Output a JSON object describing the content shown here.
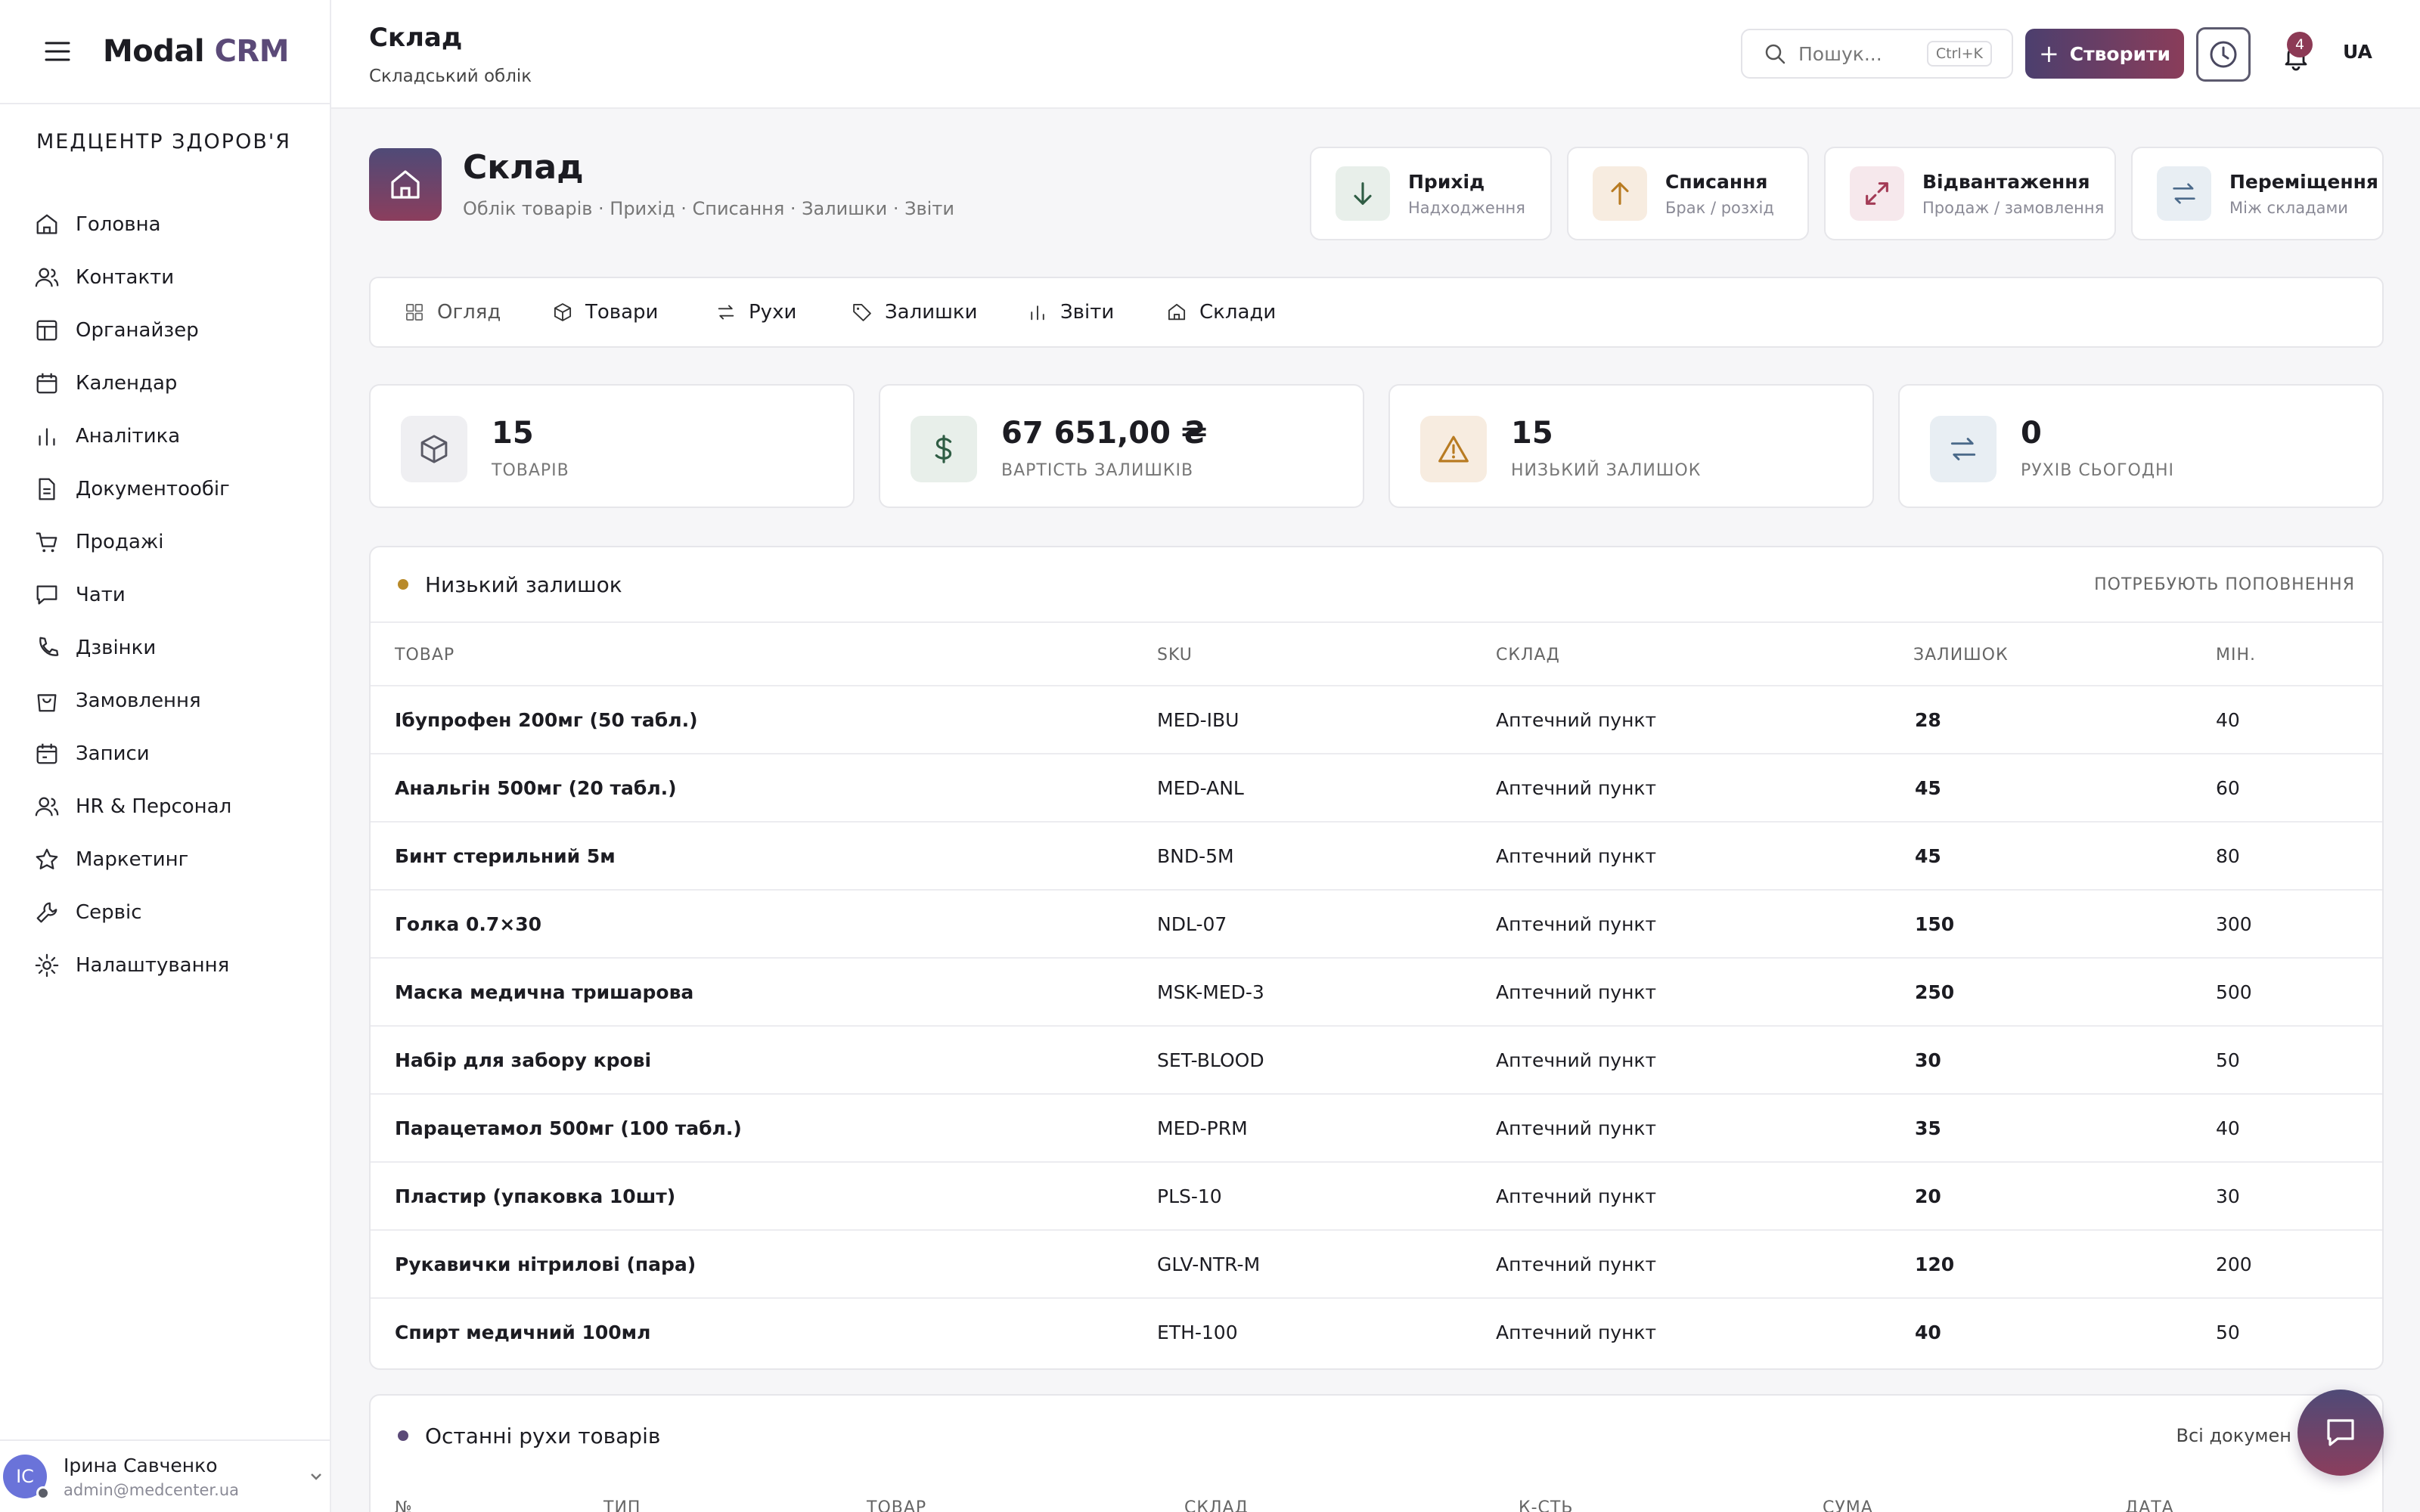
{
  "brand": {
    "name": "Modal",
    "suffix": "CRM"
  },
  "organization": "МЕДЦЕНТР ЗДОРОВ'Я",
  "sidebar": {
    "items": [
      {
        "label": "Головна",
        "icon": "home-icon"
      },
      {
        "label": "Контакти",
        "icon": "users-icon"
      },
      {
        "label": "Органайзер",
        "icon": "layout-icon"
      },
      {
        "label": "Календар",
        "icon": "calendar-icon"
      },
      {
        "label": "Аналітика",
        "icon": "bar-chart-icon"
      },
      {
        "label": "Документообіг",
        "icon": "document-icon"
      },
      {
        "label": "Продажі",
        "icon": "cart-icon"
      },
      {
        "label": "Чати",
        "icon": "chat-icon"
      },
      {
        "label": "Дзвінки",
        "icon": "phone-icon"
      },
      {
        "label": "Замовлення",
        "icon": "bag-icon"
      },
      {
        "label": "Записи",
        "icon": "calendar-check-icon"
      },
      {
        "label": "HR & Персонал",
        "icon": "users-icon"
      },
      {
        "label": "Маркетинг",
        "icon": "star-icon"
      },
      {
        "label": "Сервіс",
        "icon": "wrench-icon"
      },
      {
        "label": "Налаштування",
        "icon": "gear-icon"
      }
    ]
  },
  "user": {
    "initials": "IC",
    "name": "Ірина Савченко",
    "email": "admin@medcenter.ua"
  },
  "header": {
    "title": "Склад",
    "subtitle": "Складський облік",
    "search_placeholder": "Пошук...",
    "search_shortcut": "Ctrl+K",
    "create_label": "Створити",
    "notifications_count": "4",
    "language": "UA"
  },
  "hero": {
    "title": "Склад",
    "subtitle": "Облік товарів · Прихід · Списання · Залишки · Звіти"
  },
  "quick_actions": [
    {
      "title": "Прихід",
      "sub": "Надходження",
      "icon": "arrow-down-icon",
      "color": "#2f5d44",
      "bg": "#e8efea"
    },
    {
      "title": "Списання",
      "sub": "Брак / розхід",
      "icon": "arrow-up-icon",
      "color": "#b87b22",
      "bg": "#f7ece0"
    },
    {
      "title": "Відвантаження",
      "sub": "Продаж / замовлення",
      "icon": "expand-icon",
      "color": "#a33b56",
      "bg": "#f6e8ec"
    },
    {
      "title": "Переміщення",
      "sub": "Між складами",
      "icon": "transfer-icon",
      "color": "#4b6a8a",
      "bg": "#e8eef3"
    }
  ],
  "tabs": [
    {
      "label": "Огляд",
      "icon": "grid-icon"
    },
    {
      "label": "Товари",
      "icon": "box-icon"
    },
    {
      "label": "Рухи",
      "icon": "transfer-icon"
    },
    {
      "label": "Залишки",
      "icon": "tag-icon"
    },
    {
      "label": "Звіти",
      "icon": "bar-chart-icon"
    },
    {
      "label": "Склади",
      "icon": "home-icon"
    }
  ],
  "stats": [
    {
      "value": "15",
      "label": "ТОВАРІВ",
      "icon": "box-icon",
      "color": "#5a5a66",
      "bg": "#efeff2"
    },
    {
      "value": "67 651,00 ₴",
      "label": "ВАРТІСТЬ ЗАЛИШКІВ",
      "icon": "dollar-icon",
      "color": "#2f5d44",
      "bg": "#e8efea"
    },
    {
      "value": "15",
      "label": "НИЗЬКИЙ ЗАЛИШОК",
      "icon": "warning-icon",
      "color": "#b87b22",
      "bg": "#f7ece0"
    },
    {
      "value": "0",
      "label": "РУХІВ СЬОГОДНІ",
      "icon": "transfer-icon",
      "color": "#4b6a8a",
      "bg": "#e8eef3"
    }
  ],
  "low_stock": {
    "title": "Низький залишок",
    "right_label": "ПОТРЕБУЮТЬ ПОПОВНЕННЯ",
    "bullet_color": "#b88a2a",
    "columns": [
      "ТОВАР",
      "SKU",
      "СКЛАД",
      "ЗАЛИШОК",
      "МІН."
    ],
    "rows": [
      [
        "Ібупрофен 200мг (50 табл.)",
        "MED-IBU",
        "Аптечний пункт",
        "28",
        "40"
      ],
      [
        "Анальгін 500мг (20 табл.)",
        "MED-ANL",
        "Аптечний пункт",
        "45",
        "60"
      ],
      [
        "Бинт стерильний 5м",
        "BND-5M",
        "Аптечний пункт",
        "45",
        "80"
      ],
      [
        "Голка 0.7×30",
        "NDL-07",
        "Аптечний пункт",
        "150",
        "300"
      ],
      [
        "Маска медична тришарова",
        "MSK-MED-3",
        "Аптечний пункт",
        "250",
        "500"
      ],
      [
        "Набір для забору крові",
        "SET-BLOOD",
        "Аптечний пункт",
        "30",
        "50"
      ],
      [
        "Парацетамол 500мг (100 табл.)",
        "MED-PRM",
        "Аптечний пункт",
        "35",
        "40"
      ],
      [
        "Пластир (упаковка 10шт)",
        "PLS-10",
        "Аптечний пункт",
        "20",
        "30"
      ],
      [
        "Рукавички нітрилові (пара)",
        "GLV-NTR-M",
        "Аптечний пункт",
        "120",
        "200"
      ],
      [
        "Спирт медичний 100мл",
        "ETH-100",
        "Аптечний пункт",
        "40",
        "50"
      ]
    ]
  },
  "recent_moves": {
    "title": "Останні рухи товарів",
    "right_label": "Всі докумен",
    "bullet_color": "#5b4a78",
    "columns": [
      "№",
      "ТИП",
      "ТОВАР",
      "СКЛАД",
      "К-СТЬ",
      "СУМА",
      "ДАТА"
    ]
  },
  "colors": {
    "accent": "#5b4a78",
    "accent2": "#8c3a55"
  }
}
